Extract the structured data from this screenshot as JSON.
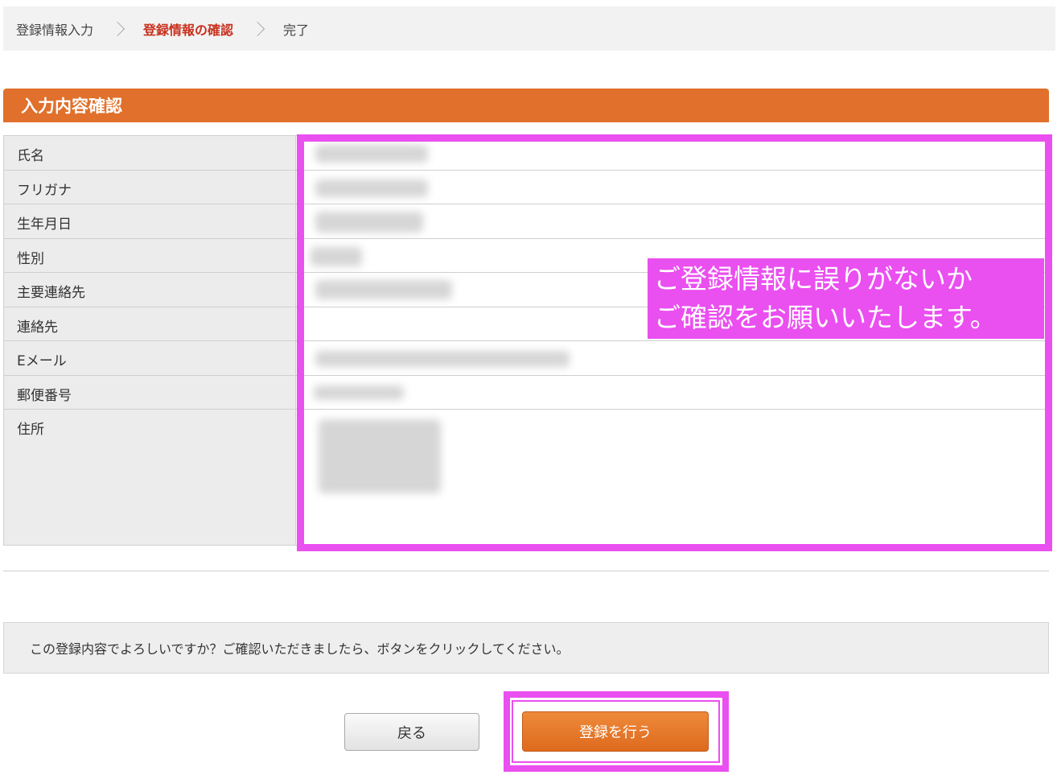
{
  "breadcrumb": {
    "step1": "登録情報入力",
    "step2": "登録情報の確認",
    "step3": "完了"
  },
  "section": {
    "title": "入力内容確認"
  },
  "fields": [
    {
      "label": "氏名"
    },
    {
      "label": "フリガナ"
    },
    {
      "label": "生年月日"
    },
    {
      "label": "性別"
    },
    {
      "label": "主要連絡先"
    },
    {
      "label": "連絡先"
    },
    {
      "label": "Eメール"
    },
    {
      "label": "郵便番号"
    },
    {
      "label": "住所"
    }
  ],
  "callout": {
    "line1": "ご登録情報に誤りがないか",
    "line2": "ご確認をお願いいたします。"
  },
  "confirm_message": "この登録内容でよろしいですか？ご確認いただきましたら、ボタンをクリックしてください。",
  "buttons": {
    "back": "戻る",
    "register": "登録を行う"
  },
  "colors": {
    "accent": "#e0702b",
    "current_step": "#c8321e",
    "highlight": "#ea4ff0"
  }
}
